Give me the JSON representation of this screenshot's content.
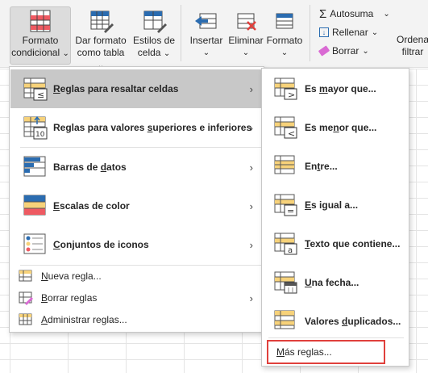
{
  "ribbon": {
    "formato_condicional": {
      "line1": "Formato",
      "line2": "condicional",
      "icon": "conditional-formatting-icon"
    },
    "dar_formato_tabla": {
      "line1": "Dar formato",
      "line2": "como tabla",
      "icon": "format-as-table-icon"
    },
    "estilos_celda": {
      "line1": "Estilos de",
      "line2": "celda",
      "icon": "cell-styles-icon"
    },
    "insertar": {
      "label": "Insertar",
      "icon": "insert-cells-icon"
    },
    "eliminar": {
      "label": "Eliminar",
      "icon": "delete-cells-icon"
    },
    "formato": {
      "label": "Formato",
      "icon": "format-cells-icon"
    },
    "autosuma": {
      "label": "Autosuma",
      "icon": "sigma-icon"
    },
    "rellenar": {
      "label": "Rellenar",
      "icon": "fill-down-icon"
    },
    "borrar": {
      "label": "Borrar",
      "icon": "eraser-icon"
    },
    "ordenar": {
      "line1": "Ordena",
      "line2": "filtrar"
    },
    "caret": "⌄"
  },
  "menu": {
    "items": [
      {
        "pre": "",
        "ul": "R",
        "post": "eglas para resaltar celdas",
        "icon": "highlight-cells-rules-icon",
        "submenu": true
      },
      {
        "pre": "Reglas para valores ",
        "ul": "s",
        "post": "uperiores e inferiores",
        "icon": "top-bottom-rules-icon",
        "submenu": true
      },
      {
        "pre": "Barras de ",
        "ul": "d",
        "post": "atos",
        "icon": "data-bars-icon",
        "submenu": true
      },
      {
        "pre": "",
        "ul": "E",
        "post": "scalas de color",
        "icon": "color-scales-icon",
        "submenu": true
      },
      {
        "pre": "",
        "ul": "C",
        "post": "onjuntos de iconos",
        "icon": "icon-sets-icon",
        "submenu": true
      },
      {
        "pre": "",
        "ul": "N",
        "post": "ueva regla...",
        "icon": "new-rule-icon",
        "submenu": false
      },
      {
        "pre": "",
        "ul": "B",
        "post": "orrar reglas",
        "icon": "clear-rules-icon",
        "submenu": true
      },
      {
        "pre": "",
        "ul": "A",
        "post": "dministrar reglas...",
        "icon": "manage-rules-icon",
        "submenu": false
      }
    ],
    "arrow": "›"
  },
  "submenu": {
    "items": [
      {
        "pre": "Es ",
        "ul": "m",
        "post": "ayor que...",
        "icon": "greater-than-icon"
      },
      {
        "pre": "Es me",
        "ul": "n",
        "post": "or que...",
        "icon": "less-than-icon"
      },
      {
        "pre": "En",
        "ul": "t",
        "post": "re...",
        "icon": "between-icon"
      },
      {
        "pre": "",
        "ul": "E",
        "post": "s igual a...",
        "icon": "equal-to-icon"
      },
      {
        "pre": "",
        "ul": "T",
        "post": "exto que contiene...",
        "icon": "text-contains-icon"
      },
      {
        "pre": "",
        "ul": "U",
        "post": "na fecha...",
        "icon": "date-occurring-icon"
      },
      {
        "pre": "Valores ",
        "ul": "d",
        "post": "uplicados...",
        "icon": "duplicate-values-icon"
      }
    ],
    "more": {
      "pre": "",
      "ul": "M",
      "post": "ás reglas..."
    }
  },
  "colors": {
    "highlight": "#c8c8c8",
    "accent_red": "#e0403c",
    "cell_yellow": "#f7d27a",
    "cell_red": "#ee5a62",
    "icon_blue": "#2b6cb0"
  }
}
